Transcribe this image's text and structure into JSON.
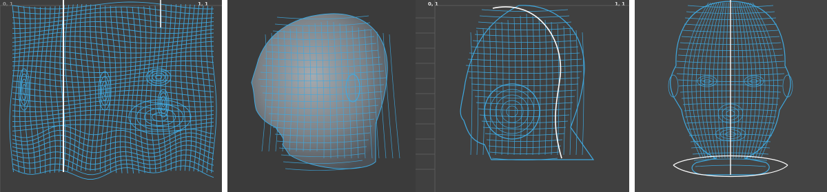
{
  "panels": [
    {
      "id": "uv-layout-flat",
      "corner_left": "0, 1",
      "corner_right": "1, 1"
    },
    {
      "id": "shaded-head-3d"
    },
    {
      "id": "uv-layout-side",
      "corner_left": "0, 1",
      "corner_right": "1, 1"
    },
    {
      "id": "uv-layout-front",
      "corner_left": "",
      "corner_right": ""
    }
  ],
  "colors": {
    "wire": "#3fa9e0",
    "seam": "#ffffff",
    "background": "#3e3e3e",
    "grid": "#5a5a5a",
    "skin": "#8a8f94"
  },
  "icons": [
    "uv-mesh-icon",
    "head-mesh-icon"
  ]
}
